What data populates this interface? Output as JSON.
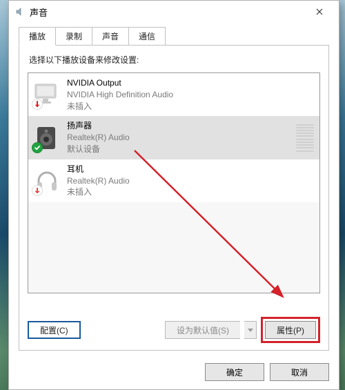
{
  "title": "声音",
  "tabs": [
    "播放",
    "录制",
    "声音",
    "通信"
  ],
  "active_tab_index": 0,
  "instruction": "选择以下播放设备来修改设置:",
  "devices": [
    {
      "icon": "monitor",
      "name": "NVIDIA Output",
      "desc": "NVIDIA High Definition Audio",
      "status": "未插入",
      "badge": "unplugged",
      "selected": false
    },
    {
      "icon": "speaker",
      "name": "扬声器",
      "desc": "Realtek(R) Audio",
      "status": "默认设备",
      "badge": "default",
      "selected": true
    },
    {
      "icon": "headphones",
      "name": "耳机",
      "desc": "Realtek(R) Audio",
      "status": "未插入",
      "badge": "unplugged",
      "selected": false
    }
  ],
  "buttons": {
    "configure": "配置(C)",
    "set_default": "设为默认值(S)",
    "properties": "属性(P)",
    "ok": "确定",
    "cancel": "取消"
  },
  "annotation": {
    "highlight_target": "properties-button",
    "color": "#d4212a"
  }
}
